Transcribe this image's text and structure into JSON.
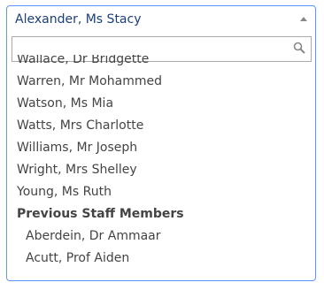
{
  "select": {
    "selected_value": "Alexander, Ms Stacy",
    "arrow_icon": "triangle-up-icon"
  },
  "search": {
    "value": "",
    "placeholder": "",
    "icon": "search-icon"
  },
  "options": [
    {
      "label": "Wallace, Dr Bridgette"
    },
    {
      "label": "Warren, Mr Mohammed"
    },
    {
      "label": "Watson, Ms Mia"
    },
    {
      "label": "Watts, Mrs Charlotte"
    },
    {
      "label": "Williams, Mr Joseph"
    },
    {
      "label": "Wright, Mrs Shelley"
    },
    {
      "label": "Young, Ms Ruth"
    }
  ],
  "group": {
    "label": "Previous Staff Members",
    "options": [
      {
        "label": "Aberdein, Dr Ammaar"
      },
      {
        "label": "Acutt, Prof Aiden"
      }
    ]
  },
  "colors": {
    "focus_border": "#5897fb",
    "selected_text": "#1a3f7a",
    "option_text": "#444444"
  }
}
